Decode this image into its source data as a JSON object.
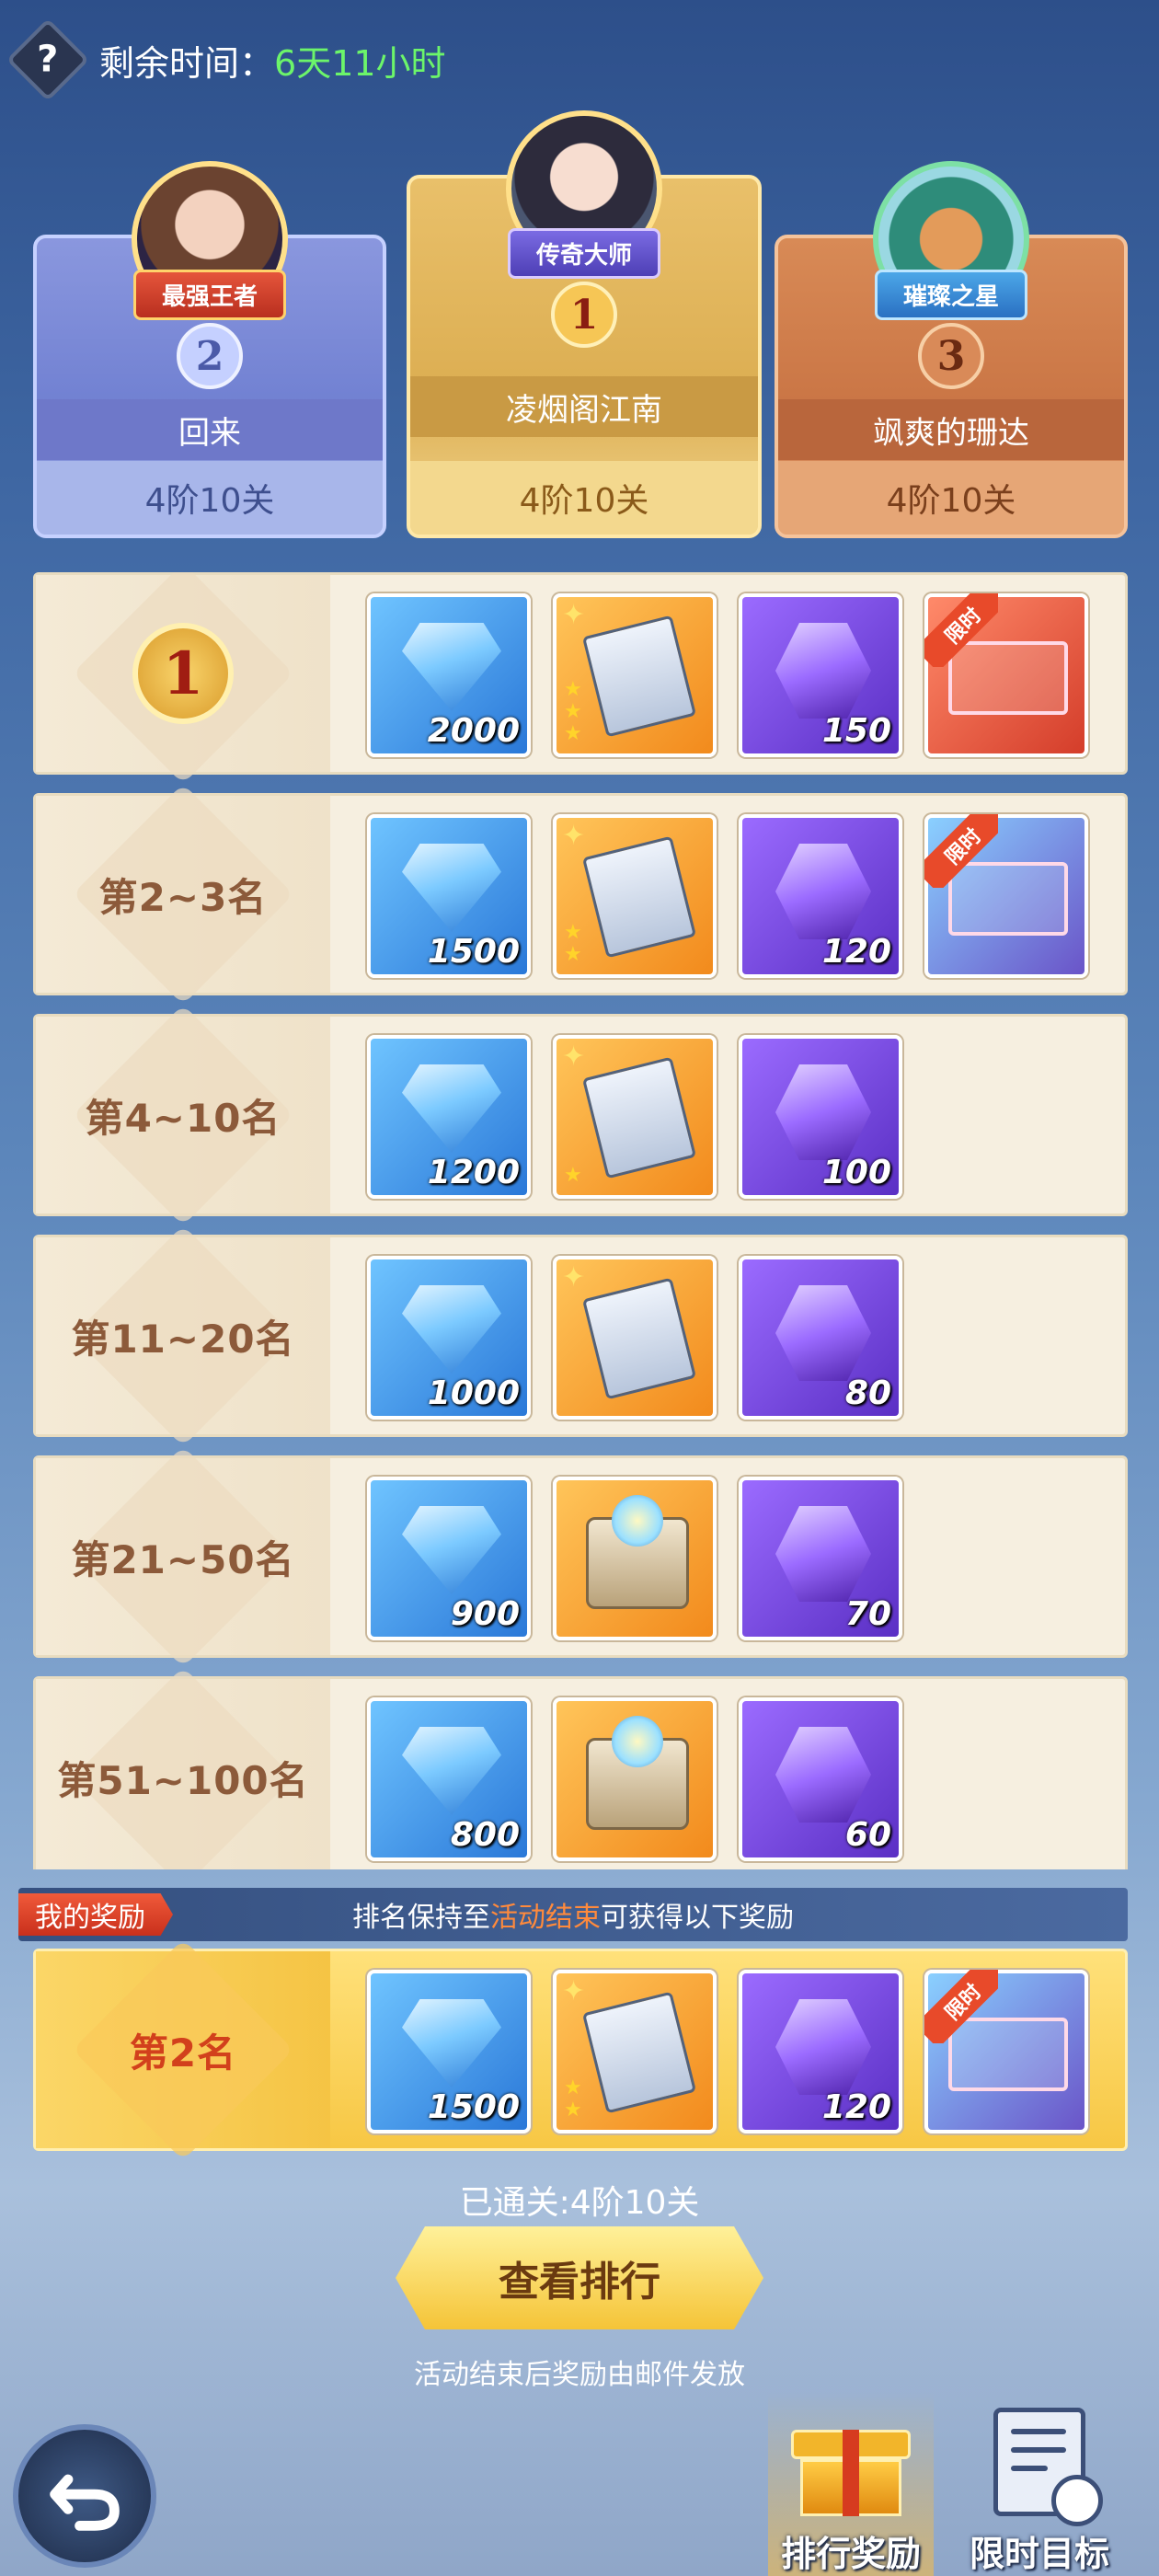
{
  "header": {
    "help_icon": "?",
    "remaining_label": "剩余时间：",
    "remaining_value": "6天11小时"
  },
  "podium": [
    {
      "rank": "2",
      "title": "最强王者",
      "name": "回来",
      "stage": "4阶10关"
    },
    {
      "rank": "1",
      "title": "传奇大师",
      "name": "凌烟阁江南",
      "stage": "4阶10关"
    },
    {
      "rank": "3",
      "title": "璀璨之星",
      "name": "飒爽的珊达",
      "stage": "4阶10关"
    }
  ],
  "rewards": [
    {
      "rank_label": "1",
      "items": [
        {
          "type": "diamond",
          "qty": "2000"
        },
        {
          "type": "scroll",
          "qty": ""
        },
        {
          "type": "purple-gem",
          "qty": "150"
        },
        {
          "type": "limited-frame-red",
          "badge": "限时"
        }
      ]
    },
    {
      "rank_label": "第2~3名",
      "items": [
        {
          "type": "diamond",
          "qty": "1500"
        },
        {
          "type": "scroll",
          "qty": ""
        },
        {
          "type": "purple-gem",
          "qty": "120"
        },
        {
          "type": "limited-frame-blue",
          "badge": "限时"
        }
      ]
    },
    {
      "rank_label": "第4~10名",
      "items": [
        {
          "type": "diamond",
          "qty": "1200"
        },
        {
          "type": "scroll",
          "qty": ""
        },
        {
          "type": "purple-gem",
          "qty": "100"
        }
      ]
    },
    {
      "rank_label": "第11~20名",
      "items": [
        {
          "type": "diamond",
          "qty": "1000"
        },
        {
          "type": "scroll",
          "qty": ""
        },
        {
          "type": "purple-gem",
          "qty": "80"
        }
      ]
    },
    {
      "rank_label": "第21~50名",
      "items": [
        {
          "type": "diamond",
          "qty": "900"
        },
        {
          "type": "orb-chest",
          "qty": ""
        },
        {
          "type": "purple-gem",
          "qty": "70"
        }
      ]
    },
    {
      "rank_label": "第51~100名",
      "items": [
        {
          "type": "diamond",
          "qty": "800"
        },
        {
          "type": "orb-chest",
          "qty": ""
        },
        {
          "type": "purple-gem",
          "qty": "60"
        }
      ]
    }
  ],
  "my_reward": {
    "tag": "我的奖励",
    "msg_prefix": "排名保持至",
    "msg_highlight": "活动结束",
    "msg_suffix": "可获得以下奖励",
    "rank_label": "第2名",
    "items": [
      {
        "type": "diamond",
        "qty": "1500"
      },
      {
        "type": "scroll",
        "qty": ""
      },
      {
        "type": "purple-gem",
        "qty": "120"
      },
      {
        "type": "limited-frame-blue",
        "badge": "限时"
      }
    ]
  },
  "footer": {
    "passed": "已通关:4阶10关",
    "view_button": "查看排行",
    "mail_note": "活动结束后奖励由邮件发放",
    "tab_rewards": "排行奖励",
    "tab_targets": "限时目标"
  },
  "colors": {
    "accent_green": "#6cf56a",
    "highlight_orange": "#ff8a3c",
    "gold": "#f5c437"
  }
}
